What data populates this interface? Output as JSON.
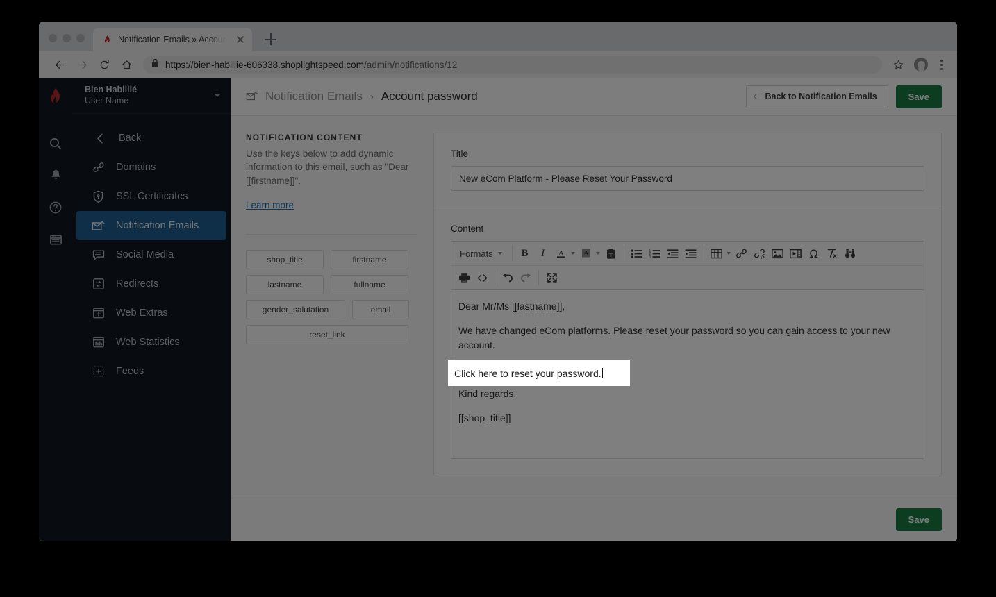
{
  "browser": {
    "tab_title": "Notification Emails » Account p",
    "favicon": "lightspeed-flame-icon",
    "url_secure": "https://bien-habillie-606338.shoplightspeed.com",
    "url_path": "/admin/notifications/12",
    "new_tab_label": "+"
  },
  "rail": {
    "logo": "lightspeed-flame-logo",
    "icons": [
      "search-icon",
      "bell-icon",
      "help-icon",
      "browser-window-icon"
    ]
  },
  "sidebar": {
    "shop_name": "Bien Habillié",
    "user_name": "User Name",
    "items": [
      {
        "label": "Back",
        "icon": "chevron-left-icon",
        "active": false
      },
      {
        "label": "Domains",
        "icon": "link-diagonal-icon",
        "active": false
      },
      {
        "label": "SSL Certificates",
        "icon": "shield-icon",
        "active": false
      },
      {
        "label": "Notification Emails",
        "icon": "mail-check-icon",
        "active": true
      },
      {
        "label": "Social Media",
        "icon": "chat-bubble-icon",
        "active": false
      },
      {
        "label": "Redirects",
        "icon": "redirect-arrows-icon",
        "active": false
      },
      {
        "label": "Web Extras",
        "icon": "window-plus-icon",
        "active": false
      },
      {
        "label": "Web Statistics",
        "icon": "bar-chart-window-icon",
        "active": false
      },
      {
        "label": "Feeds",
        "icon": "dotted-plus-icon",
        "active": false
      }
    ]
  },
  "topbar": {
    "breadcrumb_icon": "mail-check-icon",
    "breadcrumb_parent": "Notification Emails",
    "breadcrumb_separator": "›",
    "breadcrumb_current": "Account password",
    "back_button": "Back to Notification Emails",
    "save_button": "Save"
  },
  "info_panel": {
    "heading": "NOTIFICATION CONTENT",
    "description": "Use the keys below to add dynamic information to this email, such as \"Dear [[firstname]]\".",
    "link": "Learn more",
    "keys": [
      {
        "label": "shop_title",
        "width": "half"
      },
      {
        "label": "firstname",
        "width": "half"
      },
      {
        "label": "lastname",
        "width": "half"
      },
      {
        "label": "fullname",
        "width": "half"
      },
      {
        "label": "gender_salutation",
        "width": "gender"
      },
      {
        "label": "email",
        "width": "email"
      },
      {
        "label": "reset_link",
        "width": "full"
      }
    ]
  },
  "form": {
    "title_label": "Title",
    "title_value": "New eCom Platform - Please Reset Your Password",
    "title_placeholder": "",
    "content_label": "Content"
  },
  "editor": {
    "toolbar_row1": [
      {
        "name": "formats-dropdown",
        "label": "Formats",
        "icon": "formats-dropdown",
        "caret": true
      },
      {
        "name": "bold-button",
        "label": "B",
        "icon": "bold-icon",
        "caret": false
      },
      {
        "name": "italic-button",
        "label": "I",
        "icon": "italic-icon",
        "caret": false
      },
      {
        "name": "text-color-button",
        "label": "A",
        "icon": "text-color-icon",
        "caret": true
      },
      {
        "name": "background-color-button",
        "label": "A",
        "icon": "background-color-icon",
        "caret": true
      },
      {
        "name": "paste-as-text-button",
        "label": "",
        "icon": "paste-text-icon",
        "caret": false
      },
      {
        "name": "bullet-list-button",
        "label": "",
        "icon": "bullet-list-icon",
        "caret": false
      },
      {
        "name": "numbered-list-button",
        "label": "",
        "icon": "numbered-list-icon",
        "caret": false
      },
      {
        "name": "outdent-button",
        "label": "",
        "icon": "outdent-icon",
        "caret": false
      },
      {
        "name": "indent-button",
        "label": "",
        "icon": "indent-icon",
        "caret": false
      },
      {
        "name": "table-button",
        "label": "",
        "icon": "table-icon",
        "caret": true
      },
      {
        "name": "insert-link-button",
        "label": "",
        "icon": "link-icon",
        "caret": false
      },
      {
        "name": "unlink-button",
        "label": "",
        "icon": "unlink-icon",
        "caret": false
      },
      {
        "name": "insert-image-button",
        "label": "",
        "icon": "image-icon",
        "caret": false
      },
      {
        "name": "insert-media-button",
        "label": "",
        "icon": "media-icon",
        "caret": false
      },
      {
        "name": "special-character-button",
        "label": "Ω",
        "icon": "omega-icon",
        "caret": false
      },
      {
        "name": "clear-formatting-button",
        "label": "",
        "icon": "clear-formatting-icon",
        "caret": false
      },
      {
        "name": "find-replace-button",
        "label": "",
        "icon": "binoculars-icon",
        "caret": false
      }
    ],
    "toolbar_row2": [
      {
        "name": "print-button",
        "label": "",
        "icon": "printer-icon"
      },
      {
        "name": "source-code-button",
        "label": "",
        "icon": "code-icon"
      },
      {
        "name": "undo-button",
        "label": "",
        "icon": "undo-arrow-icon"
      },
      {
        "name": "redo-button",
        "label": "",
        "icon": "redo-arrow-icon"
      },
      {
        "name": "fullscreen-button",
        "label": "",
        "icon": "fullscreen-icon"
      }
    ],
    "body": {
      "line_greeting_prefix": "Dear Mr/Ms ",
      "line_greeting_key": "[[lastname]]",
      "line_greeting_suffix": ",",
      "line_paragraph": "We have changed eCom platforms. Please reset your password so you can gain access to your new account.",
      "line_selected": "Click here to reset your password.",
      "line_regards": "Kind regards,",
      "line_signature": "[[shop_title]]"
    }
  },
  "footer": {
    "save_button": "Save"
  },
  "colors": {
    "accent_green": "#1a7a42",
    "sidebar_active": "#1c5f8f",
    "link_blue": "#1f6fb2",
    "brand_red": "#b4282d",
    "sidebar_bg": "#111823",
    "rail_bg": "#10161f"
  }
}
